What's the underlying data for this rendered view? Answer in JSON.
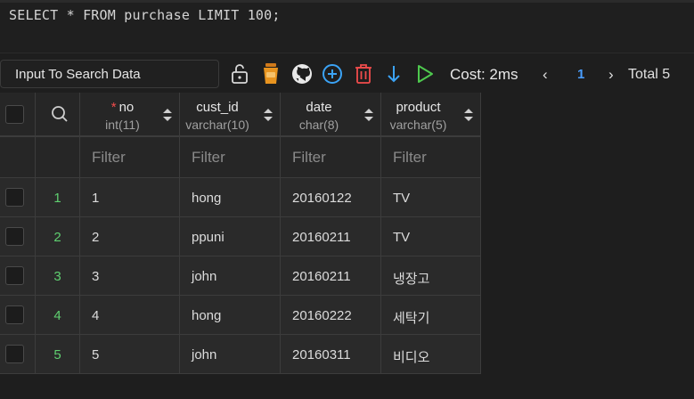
{
  "editor": {
    "query": "SELECT * FROM purchase LIMIT 100;"
  },
  "toolbar": {
    "search_placeholder": "Input To Search Data",
    "icons": [
      "unlock-icon",
      "coffee-icon",
      "github-icon",
      "add-circle-icon",
      "delete-icon",
      "arrow-down-icon",
      "run-icon"
    ],
    "cost": "Cost: 2ms",
    "pager": {
      "prev": "‹",
      "page": "1",
      "next": "›",
      "total": "Total 5"
    }
  },
  "columns": [
    {
      "name": "no",
      "type": "int(11)",
      "required": "*"
    },
    {
      "name": "cust_id",
      "type": "varchar(10)"
    },
    {
      "name": "date",
      "type": "char(8)"
    },
    {
      "name": "product",
      "type": "varchar(5)"
    }
  ],
  "filters": [
    "Filter",
    "Filter",
    "Filter",
    "Filter"
  ],
  "rows": [
    {
      "num": "1",
      "cells": [
        "1",
        "hong",
        "20160122",
        "TV"
      ]
    },
    {
      "num": "2",
      "cells": [
        "2",
        "ppuni",
        "20160211",
        "TV"
      ]
    },
    {
      "num": "3",
      "cells": [
        "3",
        "john",
        "20160211",
        "냉장고"
      ]
    },
    {
      "num": "4",
      "cells": [
        "4",
        "hong",
        "20160222",
        "세탁기"
      ]
    },
    {
      "num": "5",
      "cells": [
        "5",
        "john",
        "20160311",
        "비디오"
      ]
    }
  ],
  "colors": {
    "background": "#1e1e1e",
    "row_number": "#5fcf70",
    "page_active": "#4a9eff",
    "required": "#f14c4c"
  }
}
